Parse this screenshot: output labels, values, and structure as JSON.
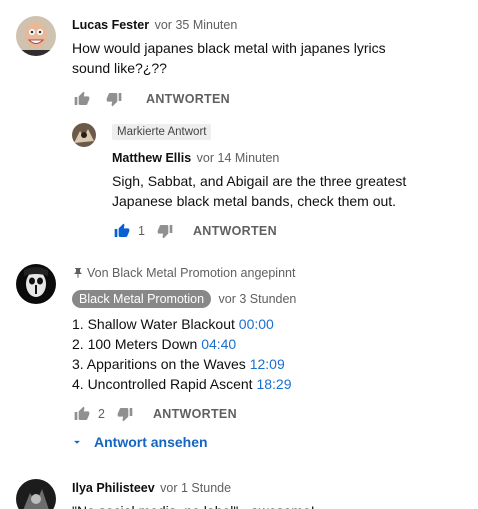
{
  "comments": [
    {
      "author": "Lucas Fester",
      "time": "vor 35 Minuten",
      "text_line1": "How would japanes black metal with japanes lyrics",
      "text_line2": "sound like?¿??",
      "reply_label": "ANTWORTEN",
      "reply": {
        "highlight_badge": "Markierte Antwort",
        "author": "Matthew Ellis",
        "time": "vor 14 Minuten",
        "text_line1": "Sigh, Sabbat, and Abigail are the three greatest",
        "text_line2": "Japanese black metal bands, check them out.",
        "likes": "1",
        "reply_label": "ANTWORTEN"
      }
    },
    {
      "pinned_label": "Von Black Metal Promotion angepinnt",
      "author": "Black Metal Promotion",
      "time": "vor 3 Stunden",
      "tracklist": [
        {
          "title": "1. Shallow Water Blackout",
          "timestamp": "00:00"
        },
        {
          "title": "2. 100 Meters Down",
          "timestamp": "04:40"
        },
        {
          "title": "3. Apparitions on the Waves",
          "timestamp": "12:09"
        },
        {
          "title": "4. Uncontrolled Rapid Ascent",
          "timestamp": "18:29"
        }
      ],
      "likes": "2",
      "reply_label": "ANTWORTEN",
      "view_replies_label": "Antwort ansehen"
    },
    {
      "author": "Ilya Philisteev",
      "time": "vor 1 Stunde",
      "text_partial": "\"No social media, no label\" - awesome!"
    }
  ],
  "colors": {
    "link": "#1a6fd0",
    "liked": "#065fd4",
    "muted": "#606060"
  }
}
